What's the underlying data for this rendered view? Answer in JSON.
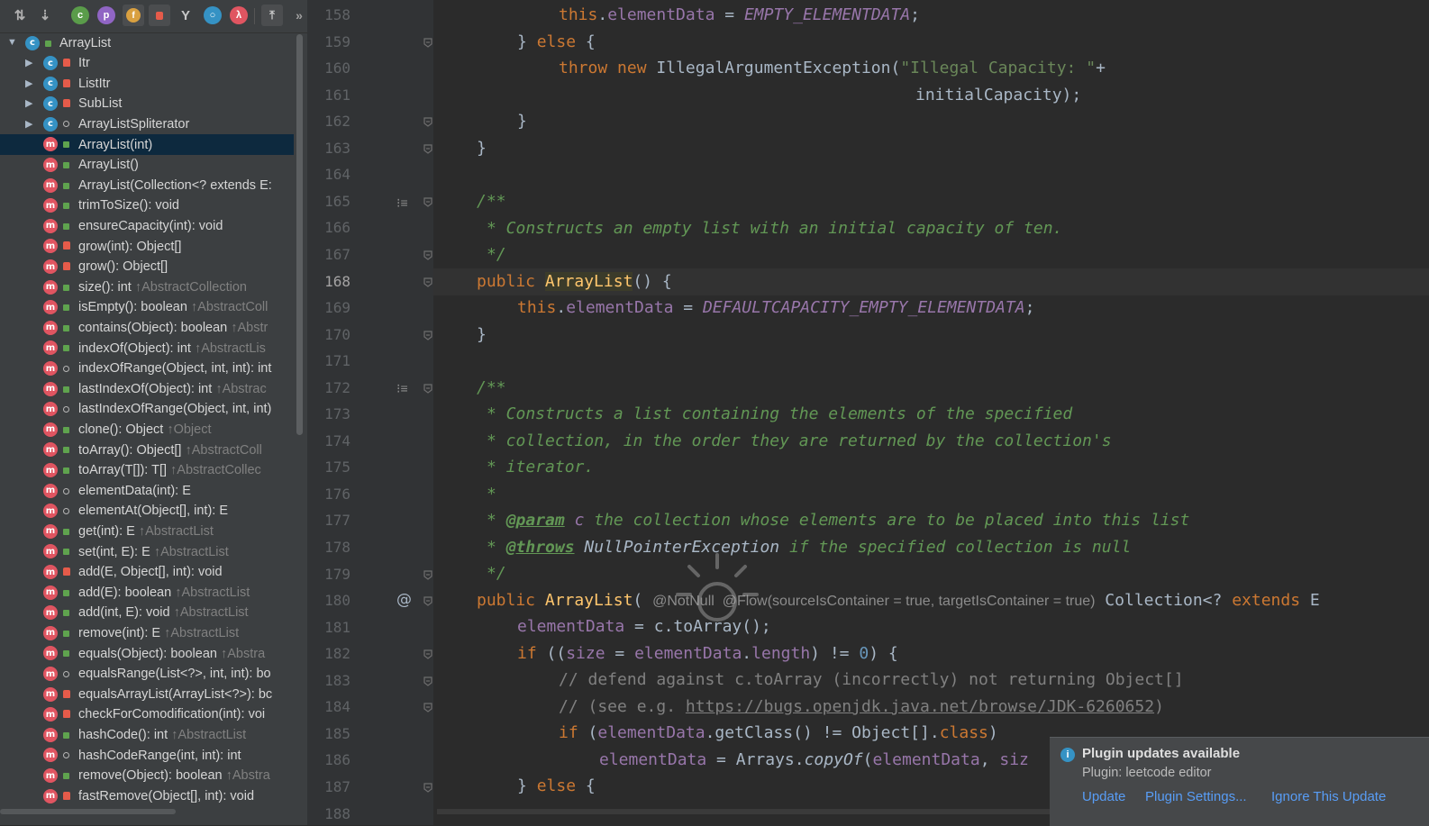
{
  "structure": {
    "toolbar": {
      "icons": [
        "sort-by-visibility-icon",
        "sort-alphabetically-icon",
        "show-inherited-icon",
        "show-properties-icon",
        "show-fields-icon",
        "show-non-public-icon",
        "show-lambdas-icon",
        "show-anonymous-icon",
        "show-lambdas-2-icon",
        "autoscroll-icon",
        "more-icon"
      ]
    },
    "root": "ArrayList",
    "nested": [
      "Itr",
      "ListItr",
      "SubList",
      "ArrayListSpliterator"
    ],
    "members": [
      {
        "label": "ArrayList(int)",
        "inherit": "",
        "vis": "public"
      },
      {
        "label": "ArrayList()",
        "inherit": "",
        "vis": "public"
      },
      {
        "label": "ArrayList(Collection<? extends E:",
        "inherit": "",
        "vis": "public"
      },
      {
        "label": "trimToSize(): void",
        "inherit": "",
        "vis": "public"
      },
      {
        "label": "ensureCapacity(int): void",
        "inherit": "",
        "vis": "public"
      },
      {
        "label": "grow(int): Object[]",
        "inherit": "",
        "vis": "private"
      },
      {
        "label": "grow(): Object[]",
        "inherit": "",
        "vis": "private"
      },
      {
        "label": "size(): int ",
        "inherit": "↑AbstractCollection",
        "vis": "public"
      },
      {
        "label": "isEmpty(): boolean ",
        "inherit": "↑AbstractColl",
        "vis": "public"
      },
      {
        "label": "contains(Object): boolean ",
        "inherit": "↑Abstr",
        "vis": "public"
      },
      {
        "label": "indexOf(Object): int ",
        "inherit": "↑AbstractLis",
        "vis": "public"
      },
      {
        "label": "indexOfRange(Object, int, int): int",
        "inherit": "",
        "vis": "package"
      },
      {
        "label": "lastIndexOf(Object): int ",
        "inherit": "↑Abstrac",
        "vis": "public"
      },
      {
        "label": "lastIndexOfRange(Object, int, int)",
        "inherit": "",
        "vis": "package"
      },
      {
        "label": "clone(): Object ",
        "inherit": "↑Object",
        "vis": "public"
      },
      {
        "label": "toArray(): Object[] ",
        "inherit": "↑AbstractColl",
        "vis": "public"
      },
      {
        "label": "toArray(T[]): T[] ",
        "inherit": "↑AbstractCollec",
        "vis": "public"
      },
      {
        "label": "elementData(int): E",
        "inherit": "",
        "vis": "package"
      },
      {
        "label": "elementAt(Object[], int): E",
        "inherit": "",
        "vis": "package"
      },
      {
        "label": "get(int): E ",
        "inherit": "↑AbstractList",
        "vis": "public"
      },
      {
        "label": "set(int, E): E ",
        "inherit": "↑AbstractList",
        "vis": "public"
      },
      {
        "label": "add(E, Object[], int): void",
        "inherit": "",
        "vis": "private"
      },
      {
        "label": "add(E): boolean ",
        "inherit": "↑AbstractList",
        "vis": "public"
      },
      {
        "label": "add(int, E): void ",
        "inherit": "↑AbstractList",
        "vis": "public"
      },
      {
        "label": "remove(int): E ",
        "inherit": "↑AbstractList",
        "vis": "public"
      },
      {
        "label": "equals(Object): boolean ",
        "inherit": "↑Abstra",
        "vis": "public"
      },
      {
        "label": "equalsRange(List<?>, int, int): bo",
        "inherit": "",
        "vis": "package"
      },
      {
        "label": "equalsArrayList(ArrayList<?>): bc",
        "inherit": "",
        "vis": "private"
      },
      {
        "label": "checkForComodification(int): voi",
        "inherit": "",
        "vis": "private"
      },
      {
        "label": "hashCode(): int ",
        "inherit": "↑AbstractList",
        "vis": "public"
      },
      {
        "label": "hashCodeRange(int, int): int",
        "inherit": "",
        "vis": "package"
      },
      {
        "label": "remove(Object): boolean ",
        "inherit": "↑Abstra",
        "vis": "public"
      },
      {
        "label": "fastRemove(Object[], int): void",
        "inherit": "",
        "vis": "private"
      }
    ],
    "selected": "ArrayList(int)"
  },
  "editor": {
    "line_numbers": [
      "158",
      "159",
      "160",
      "161",
      "162",
      "163",
      "164",
      "165",
      "166",
      "167",
      "168",
      "169",
      "170",
      "171",
      "172",
      "173",
      "174",
      "175",
      "176",
      "177",
      "178",
      "179",
      "180",
      "181",
      "182",
      "183",
      "184",
      "185",
      "186",
      "187",
      "188"
    ],
    "current_line": "168"
  },
  "notification": {
    "title": "Plugin updates available",
    "text": "Plugin: leetcode editor",
    "actions": [
      "Update",
      "Plugin Settings...",
      "Ignore This Update"
    ]
  },
  "colors": {
    "background": "#2b2b2b",
    "panel": "#3c3f41",
    "selection": "#0d293e",
    "keyword": "#cc7832",
    "string": "#6a8759",
    "field": "#9876aa",
    "doc": "#629755",
    "link": "#589df6"
  }
}
